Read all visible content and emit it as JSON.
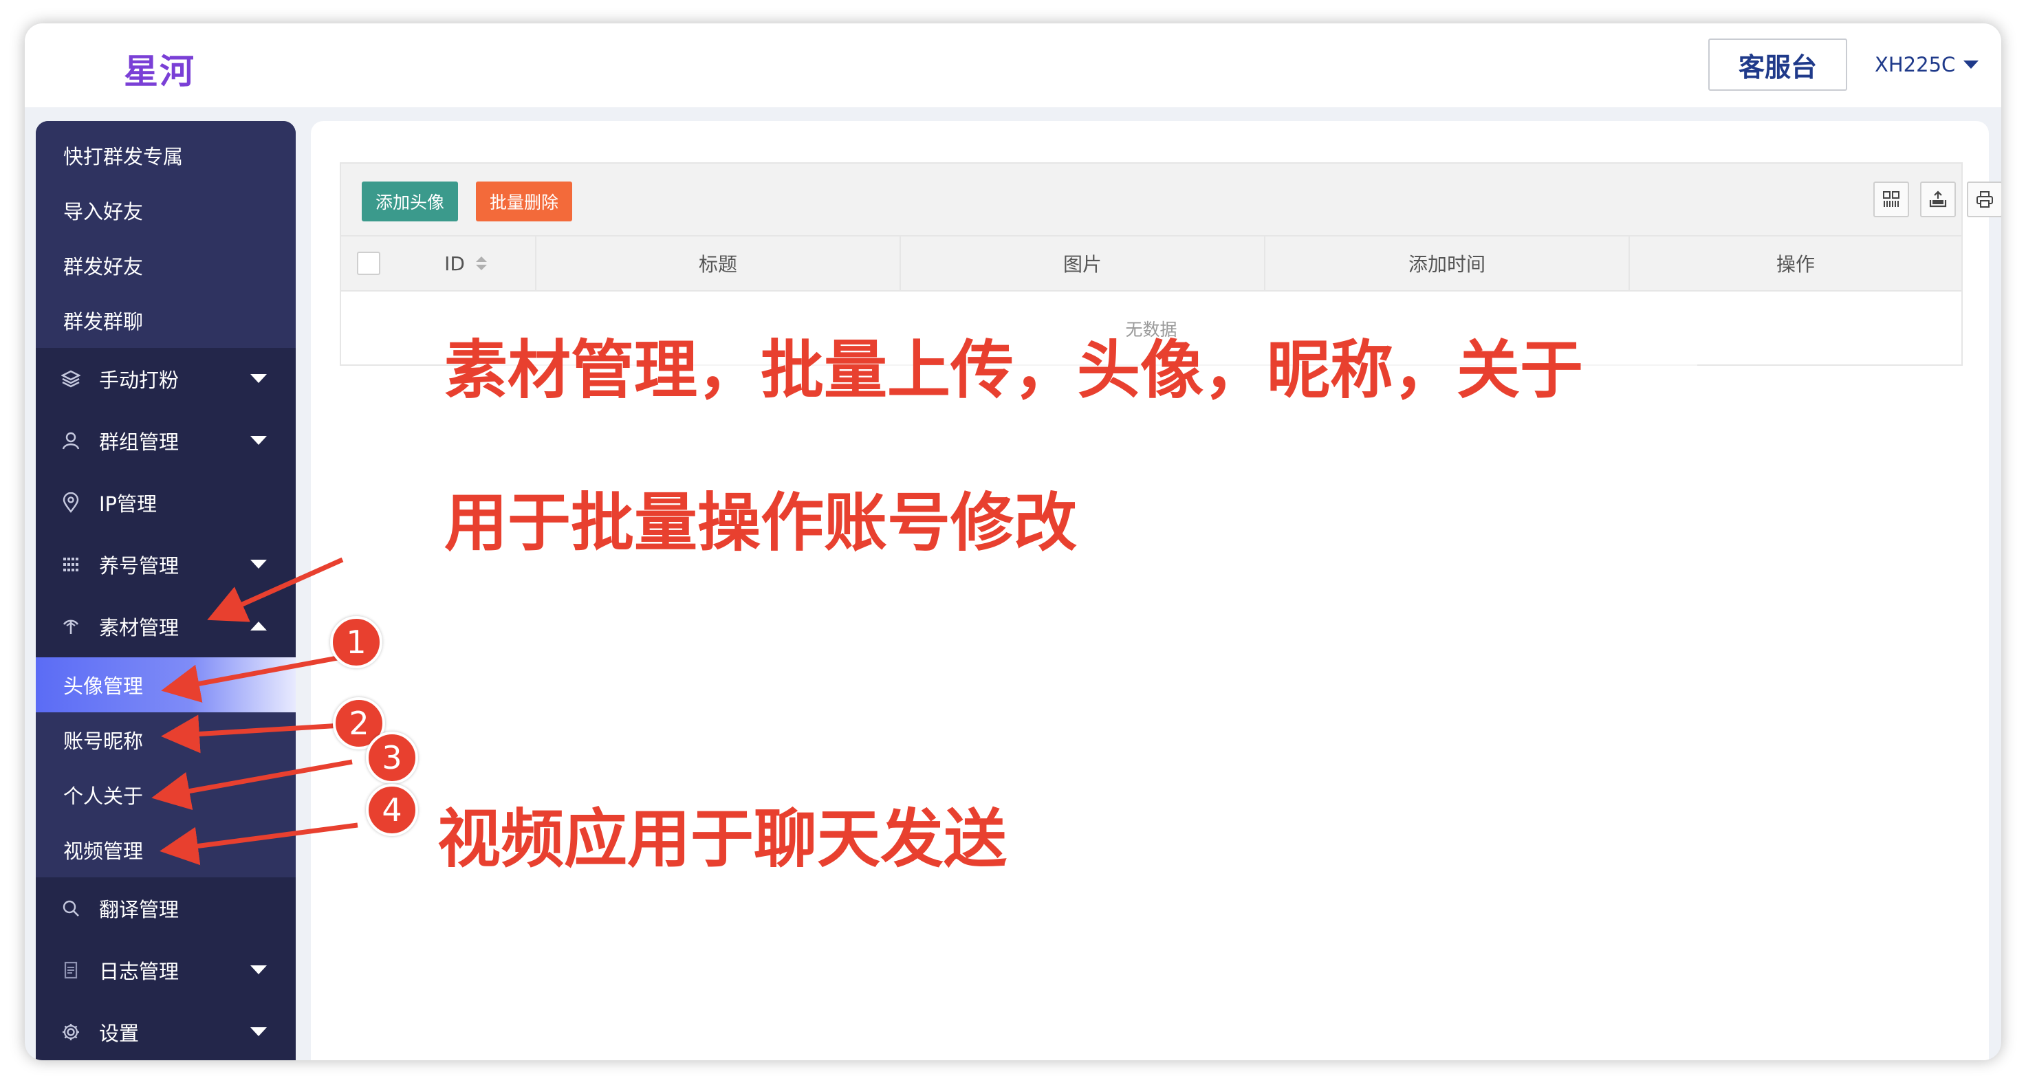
{
  "app": {
    "logo": "星河"
  },
  "header": {
    "service_label": "客服台",
    "user_name": "XH225C"
  },
  "sidebar": {
    "top_items": [
      "快打群发专属",
      "导入好友",
      "群发好友",
      "群发群聊"
    ],
    "menus": [
      {
        "label": "手动打粉",
        "icon": "layers-icon",
        "arrow": "down"
      },
      {
        "label": "群组管理",
        "icon": "user-icon",
        "arrow": "down"
      },
      {
        "label": "IP管理",
        "icon": "location-pin-icon",
        "arrow": ""
      },
      {
        "label": "养号管理",
        "icon": "grid-dots-icon",
        "arrow": "down"
      },
      {
        "label": "素材管理",
        "icon": "material-icon",
        "arrow": "up"
      }
    ],
    "material_items": [
      {
        "label": "头像管理",
        "active": true
      },
      {
        "label": "账号昵称"
      },
      {
        "label": "个人关于"
      },
      {
        "label": "视频管理"
      }
    ],
    "bottom_menus": [
      {
        "label": "翻译管理",
        "icon": "search-icon",
        "arrow": ""
      },
      {
        "label": "日志管理",
        "icon": "document-icon",
        "arrow": "down"
      },
      {
        "label": "设置",
        "icon": "gear-icon",
        "arrow": "down"
      }
    ]
  },
  "toolbar": {
    "add_label": "添加头像",
    "delete_label": "批量删除",
    "icons": [
      "columns-icon",
      "export-icon",
      "print-icon"
    ]
  },
  "table": {
    "columns": [
      "ID",
      "标题",
      "图片",
      "添加时间",
      "操作"
    ],
    "empty_text": "无数据"
  },
  "annotations": {
    "line1": "素材管理，批量上传，头像，昵称，关于",
    "line2": "用于批量操作账号修改",
    "line3": "视频应用于聊天发送",
    "badges": [
      "1",
      "2",
      "3",
      "4"
    ]
  },
  "colors": {
    "sidebar_bg": "#23264a",
    "sidebar_group_bg": "#2f3360",
    "active_item": "#5b6cf5",
    "logo": "#7a3fd6",
    "annotation_red": "#e8402f",
    "add_button": "#3b9a8c",
    "delete_button": "#f36a3a"
  }
}
